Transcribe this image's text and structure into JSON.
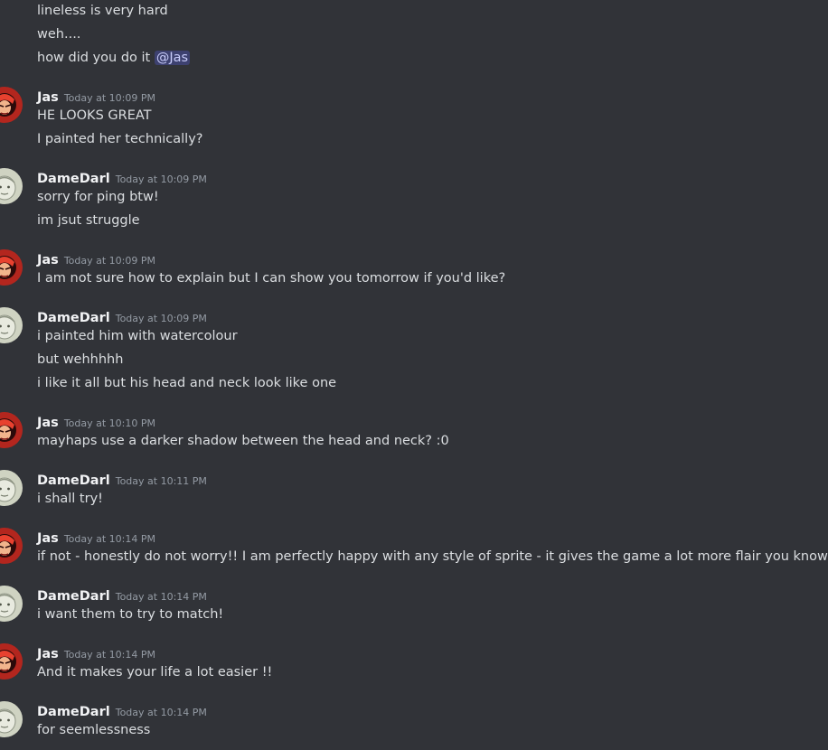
{
  "messages": [
    {
      "kind": "continuation",
      "text": "lineless is very hard"
    },
    {
      "kind": "continuation",
      "text": "weh...."
    },
    {
      "kind": "continuation",
      "text": "how did you do it ",
      "mention": "@Jas"
    },
    {
      "kind": "header",
      "author": "Jas",
      "time": "Today at 10:09 PM",
      "avatar": "jas-avatar"
    },
    {
      "kind": "continuation",
      "text": "HE LOOKS GREAT"
    },
    {
      "kind": "continuation",
      "text": "I painted her technically?"
    },
    {
      "kind": "header",
      "author": "DameDarl",
      "time": "Today at 10:09 PM",
      "avatar": "damedarl-avatar"
    },
    {
      "kind": "continuation",
      "text": "sorry for ping btw!"
    },
    {
      "kind": "continuation",
      "text": "im jsut struggle"
    },
    {
      "kind": "header",
      "author": "Jas",
      "time": "Today at 10:09 PM",
      "avatar": "jas-avatar"
    },
    {
      "kind": "continuation",
      "text": "I am not sure how to explain but I can show you tomorrow if you'd like?"
    },
    {
      "kind": "header",
      "author": "DameDarl",
      "time": "Today at 10:09 PM",
      "avatar": "damedarl-avatar"
    },
    {
      "kind": "continuation",
      "text": "i painted him with watercolour"
    },
    {
      "kind": "continuation",
      "text": "but wehhhhh"
    },
    {
      "kind": "continuation",
      "text": "i like it all but his head and neck look like one"
    },
    {
      "kind": "header",
      "author": "Jas",
      "time": "Today at 10:10 PM",
      "avatar": "jas-avatar"
    },
    {
      "kind": "continuation",
      "text": "mayhaps use a darker shadow between the head and neck? :0"
    },
    {
      "kind": "header",
      "author": "DameDarl",
      "time": "Today at 10:11 PM",
      "avatar": "damedarl-avatar"
    },
    {
      "kind": "continuation",
      "text": "i shall try!"
    },
    {
      "kind": "header",
      "author": "Jas",
      "time": "Today at 10:14 PM",
      "avatar": "jas-avatar"
    },
    {
      "kind": "continuation",
      "text": "if not - honestly do not worry!! I am perfectly happy with any style of sprite - it gives the game a lot more flair you know?"
    },
    {
      "kind": "header",
      "author": "DameDarl",
      "time": "Today at 10:14 PM",
      "avatar": "damedarl-avatar"
    },
    {
      "kind": "continuation",
      "text": "i want them to try to match!"
    },
    {
      "kind": "header",
      "author": "Jas",
      "time": "Today at 10:14 PM",
      "avatar": "jas-avatar"
    },
    {
      "kind": "continuation",
      "text": "And it makes your life a lot easier !!"
    },
    {
      "kind": "header",
      "author": "DameDarl",
      "time": "Today at 10:14 PM",
      "avatar": "damedarl-avatar"
    },
    {
      "kind": "continuation",
      "text": "for seemlessness"
    }
  ],
  "colors": {
    "background": "#313338",
    "text": "#dbdee1",
    "author": "#f2f3f5",
    "timestamp": "#949ba4",
    "mention_bg": "#5865f24d",
    "mention_text": "#c9cdfb"
  }
}
